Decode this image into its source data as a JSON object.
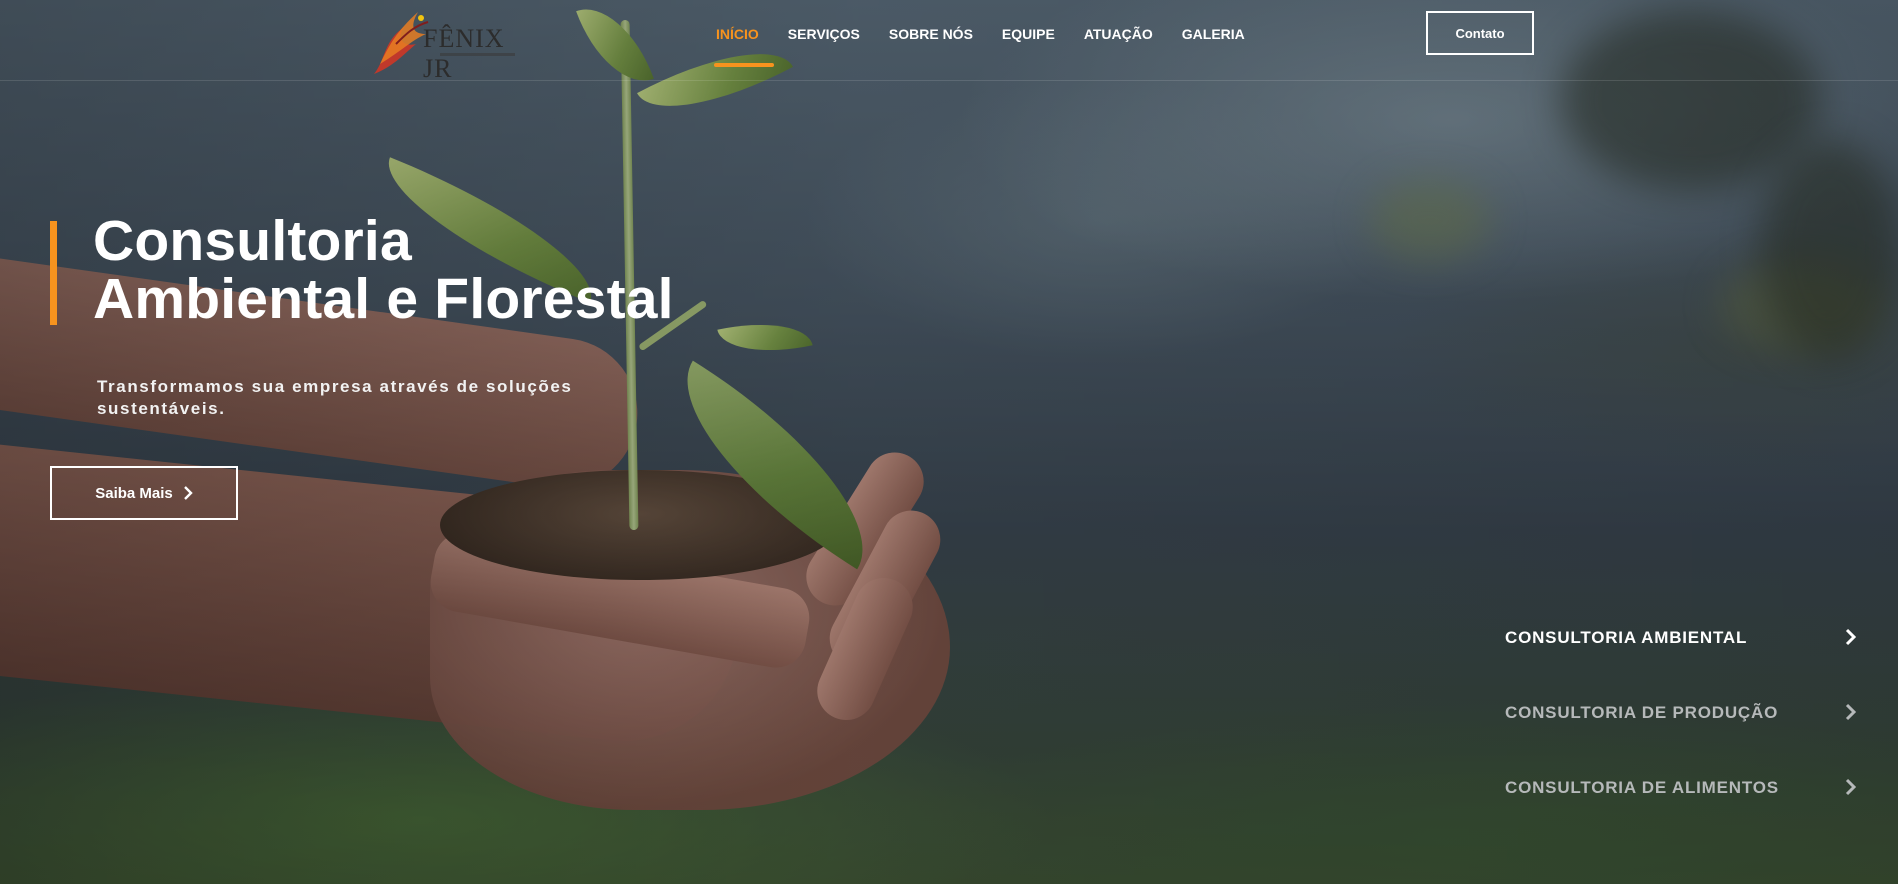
{
  "brand": {
    "name": "FÊNIX JR",
    "icon": "phoenix-logo-icon",
    "accent_color": "#f7931e"
  },
  "nav": {
    "items": [
      {
        "label": "INÍCIO",
        "active": true
      },
      {
        "label": "SERVIÇOS",
        "active": false
      },
      {
        "label": "SOBRE NÓS",
        "active": false
      },
      {
        "label": "EQUIPE",
        "active": false
      },
      {
        "label": "ATUAÇÃO",
        "active": false
      },
      {
        "label": "GALERIA",
        "active": false
      }
    ],
    "contact_label": "Contato"
  },
  "hero": {
    "title_line1": "Consultoria",
    "title_line2": "Ambiental e Florestal",
    "subtitle": "Transformamos sua empresa através de soluções sustentáveis.",
    "cta_label": "Saiba Mais",
    "cta_icon": "chevron-right-icon"
  },
  "services": {
    "items": [
      {
        "label": "CONSULTORIA AMBIENTAL",
        "active": true,
        "icon": "chevron-right-icon"
      },
      {
        "label": "CONSULTORIA DE PRODUÇÃO",
        "active": false,
        "icon": "chevron-right-icon"
      },
      {
        "label": "CONSULTORIA DE ALIMENTOS",
        "active": false,
        "icon": "chevron-right-icon"
      }
    ]
  }
}
